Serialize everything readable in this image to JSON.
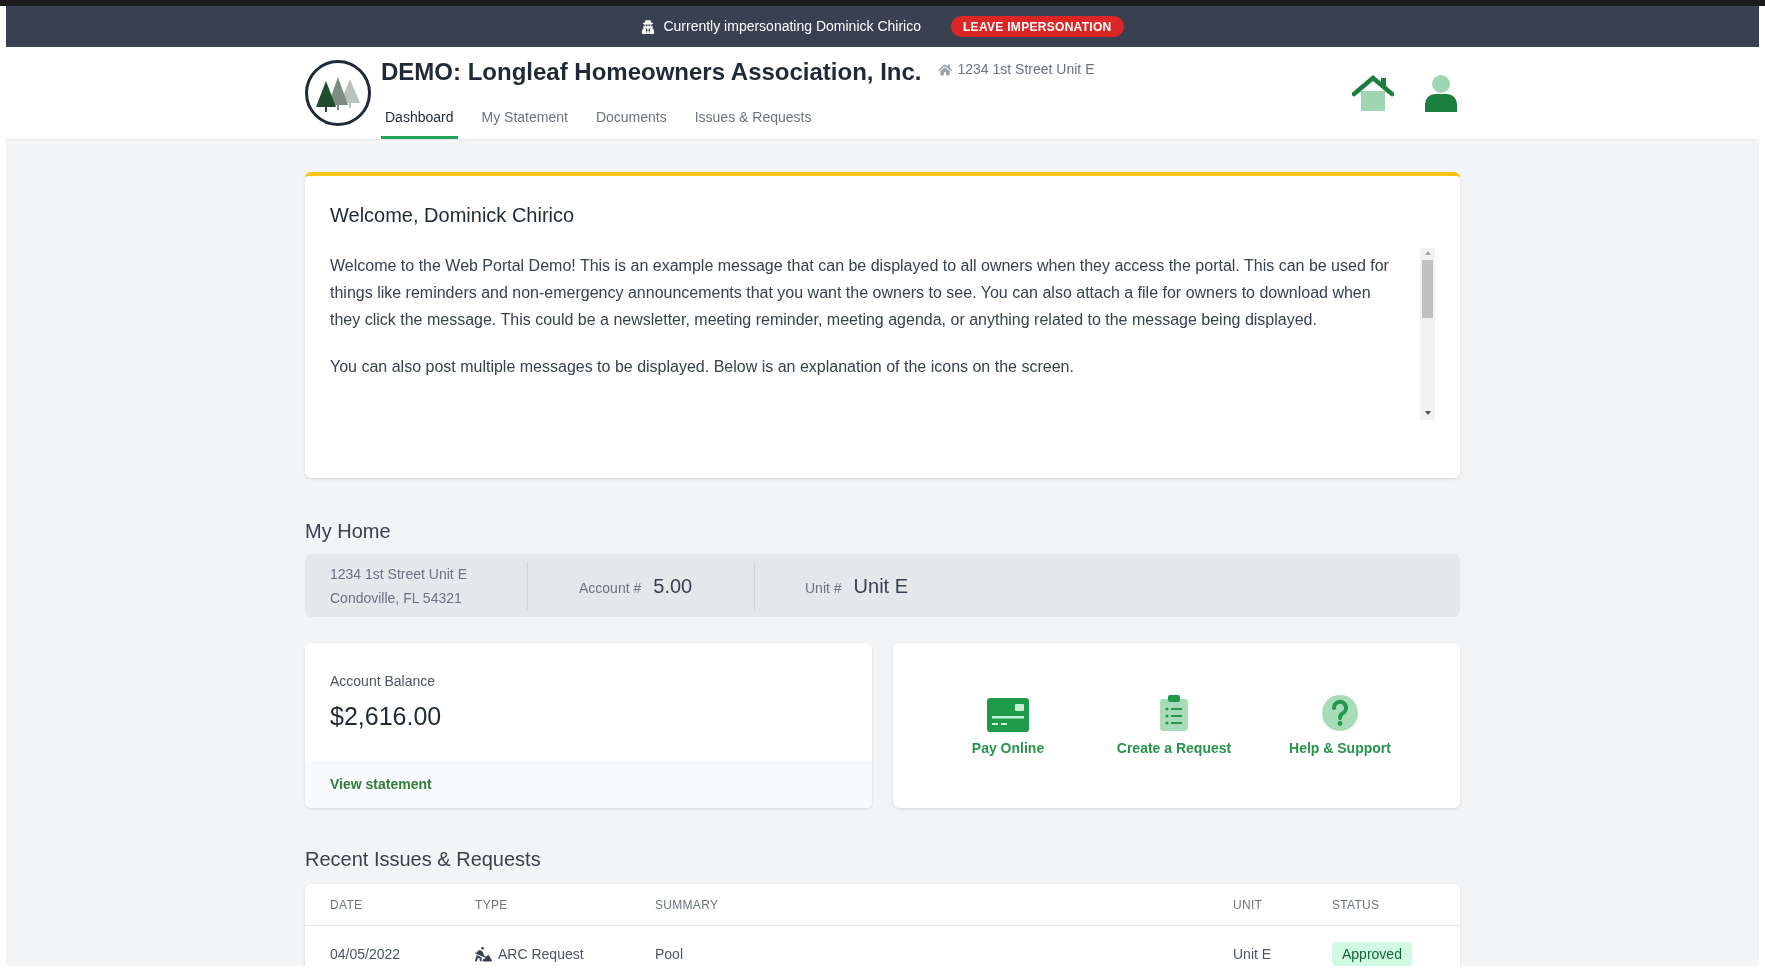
{
  "banner": {
    "text": "Currently impersonating Dominick Chirico",
    "button": "LEAVE IMPERSONATION"
  },
  "header": {
    "title": "DEMO: Longleaf Homeowners Association, Inc.",
    "address": "1234 1st Street Unit E",
    "tabs": [
      {
        "label": "Dashboard",
        "selected": true
      },
      {
        "label": "My Statement",
        "selected": false
      },
      {
        "label": "Documents",
        "selected": false
      },
      {
        "label": "Issues & Requests",
        "selected": false
      }
    ]
  },
  "welcome": {
    "title": "Welcome, Dominick Chirico",
    "paragraphs": [
      "Welcome to the Web Portal Demo! This is an example message that can be displayed to all owners when they access the portal. This can be used for things like reminders and non-emergency announcements that you want the owners to see. You can also attach a file for owners to download when they click the message. This could be a newsletter, meeting reminder, meeting agenda, or anything related to the message being displayed.",
      "You can also post multiple messages to be displayed. Below is an explanation of the icons on the screen."
    ]
  },
  "my_home": {
    "heading": "My Home",
    "address_lines": [
      "1234 1st Street Unit E",
      "Condoville, FL 54321"
    ],
    "account_label": "Account #",
    "account_value": "5.00",
    "unit_label": "Unit #",
    "unit_value": "Unit E"
  },
  "balance": {
    "label": "Account Balance",
    "amount": "$2,616.00",
    "link": "View statement"
  },
  "actions": [
    {
      "kind": "card",
      "label": "Pay Online"
    },
    {
      "kind": "clipboard",
      "label": "Create a Request"
    },
    {
      "kind": "help",
      "label": "Help & Support"
    }
  ],
  "recent": {
    "heading": "Recent Issues & Requests",
    "columns": [
      "DATE",
      "TYPE",
      "SUMMARY",
      "UNIT",
      "STATUS"
    ],
    "rows": [
      {
        "date": "04/05/2022",
        "type": "ARC Request",
        "summary": "Pool",
        "unit": "Unit E",
        "status": "Approved"
      }
    ]
  }
}
